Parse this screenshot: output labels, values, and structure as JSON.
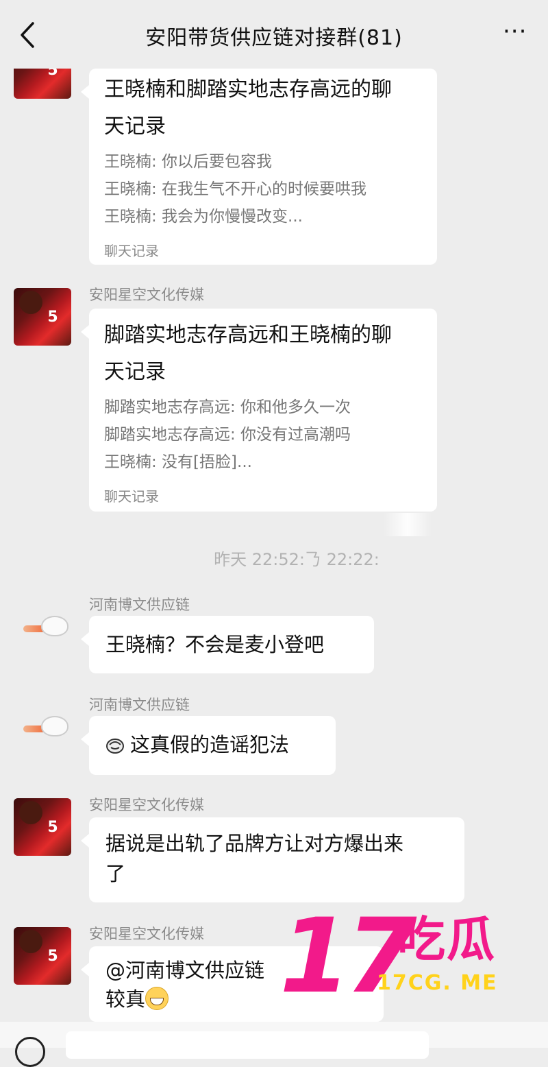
{
  "header": {
    "back_icon": "chevron-left-icon",
    "title": "安阳带货供应链对接群(81)",
    "more_label": "···"
  },
  "messages": [
    {
      "sender": "",
      "avatar": "red-jersey-avatar",
      "type": "chat-record",
      "title": "王晓楠和脚踏实地志存高远的聊天记录",
      "title_line1": "王晓楠和脚踏实地志存高远的聊",
      "title_line2": "天记录",
      "lines": [
        "王晓楠: 你以后要包容我",
        "王晓楠: 在我生气不开心的时候要哄我",
        "王晓楠: 我会为你慢慢改变..."
      ],
      "footer": "聊天记录"
    },
    {
      "sender": "安阳星空文化传媒",
      "avatar": "red-jersey-avatar",
      "type": "chat-record",
      "title_line1": "脚踏实地志存高远和王晓楠的聊",
      "title_line2": "天记录",
      "lines": [
        "脚踏实地志存高远: 你和他多久一次",
        "脚踏实地志存高远: 你没有过高潮吗",
        "王晓楠: 没有[捂脸]..."
      ],
      "footer": "聊天记录"
    },
    {
      "sender": "河南博文供应链",
      "avatar": "egg-avatar",
      "type": "text",
      "text": "王晓楠？不会是麦小登吧"
    },
    {
      "sender": "河南博文供应链",
      "avatar": "egg-avatar",
      "type": "text",
      "emoji": "facepalm-emoji-icon",
      "text": "这真假的造谣犯法"
    },
    {
      "sender": "安阳星空文化传媒",
      "avatar": "red-jersey-avatar",
      "type": "text",
      "text_line1": "据说是出轨了品牌方让对方爆出来",
      "text_line2": "了"
    },
    {
      "sender": "安阳星空文化传媒",
      "avatar": "red-jersey-avatar",
      "type": "text",
      "text_line1": "@河南博文供应链",
      "text_line2": "较真",
      "emoji": "grin-emoji-icon"
    }
  ],
  "timestamp": "昨天 22:5‹:Ŕ 22:22:",
  "timestamp_display": "昨天 22:52:𠄎 22:22:",
  "watermark": {
    "number": "17",
    "chinese": "吃瓜",
    "site": "17CG. ME",
    "color_pink": "#f21a8a",
    "color_yellow": "#ffd21a"
  },
  "colors": {
    "background": "#ededed",
    "bubble": "#ffffff",
    "sender_text": "#8a8a8a",
    "record_text": "#777777"
  }
}
